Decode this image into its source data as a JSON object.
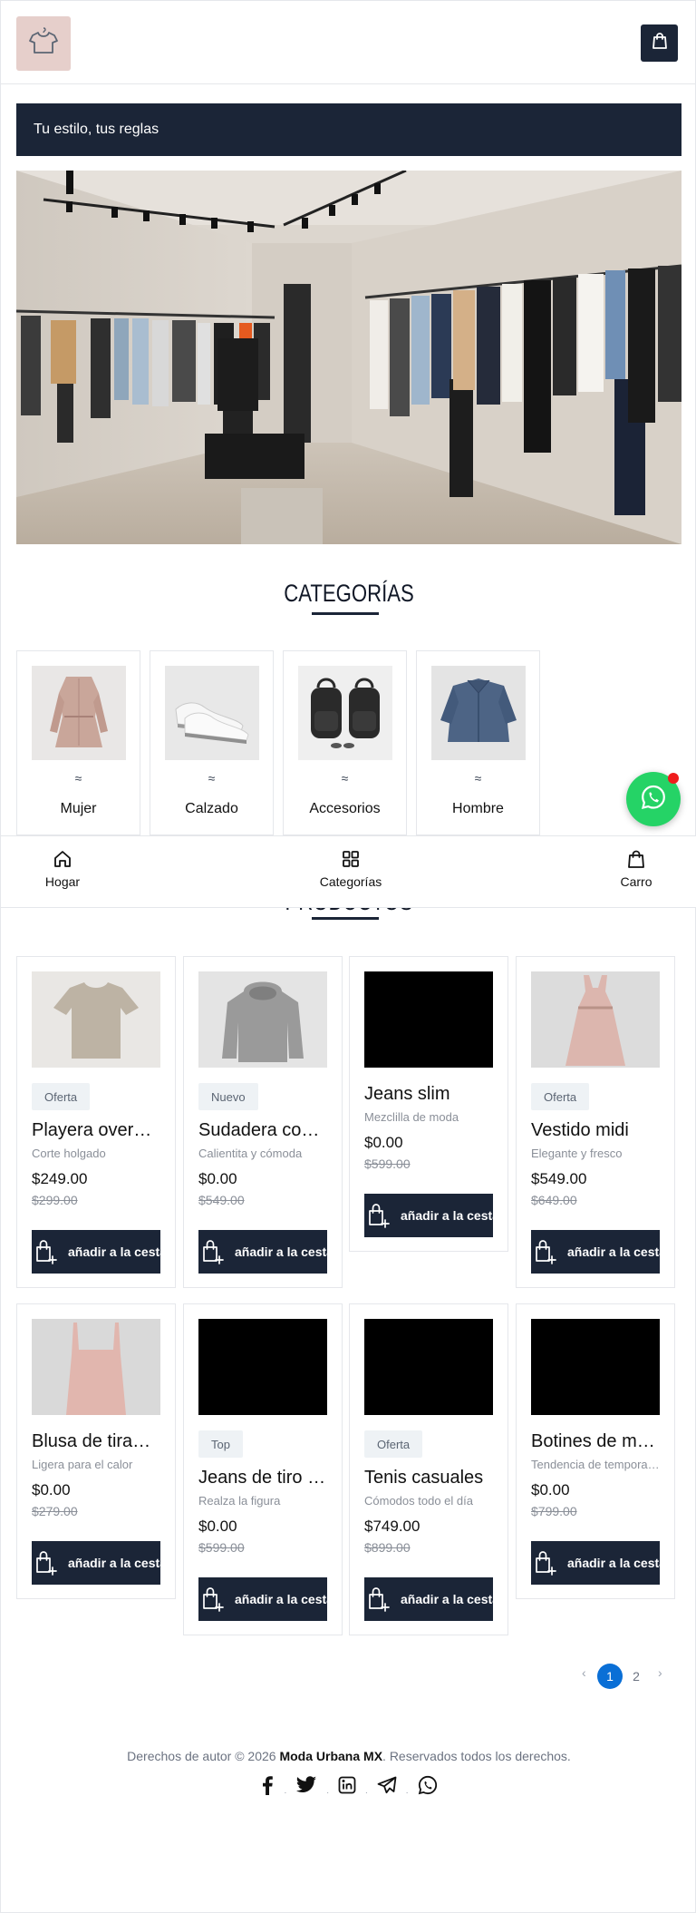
{
  "header": {
    "logo_icon": "tshirt-icon",
    "cart_icon": "shopping-bag-icon"
  },
  "banner": {
    "text": "Tu estilo, tus reglas"
  },
  "categories": {
    "title": "CATEGORÍAS",
    "items": [
      {
        "symbol": "≈",
        "label": "Mujer"
      },
      {
        "symbol": "≈",
        "label": "Calzado"
      },
      {
        "symbol": "≈",
        "label": "Accesorios"
      },
      {
        "symbol": "≈",
        "label": "Hombre"
      }
    ]
  },
  "products_title": "PRODUCTOS",
  "products": [
    {
      "badge": "Oferta",
      "name": "Playera oversize",
      "desc": "Corte holgado",
      "price": "$249.00",
      "old": "$299.00",
      "button": "añadir a la cesta"
    },
    {
      "badge": "Nuevo",
      "name": "Sudadera con capucha",
      "desc": "Calientita y cómoda",
      "price": "$0.00",
      "old": "$549.00",
      "button": "añadir a la cesta"
    },
    {
      "badge": "",
      "name": "Jeans slim",
      "desc": "Mezclilla de moda",
      "price": "$0.00",
      "old": "$599.00",
      "button": "añadir a la cesta"
    },
    {
      "badge": "Oferta",
      "name": "Vestido midi",
      "desc": "Elegante y fresco",
      "price": "$549.00",
      "old": "$649.00",
      "button": "añadir a la cesta"
    },
    {
      "badge": "",
      "name": "Blusa de tirantes",
      "desc": "Ligera para el calor",
      "price": "$0.00",
      "old": "$279.00",
      "button": "añadir a la cesta"
    },
    {
      "badge": "Top",
      "name": "Jeans de tiro alto",
      "desc": "Realza la figura",
      "price": "$0.00",
      "old": "$599.00",
      "button": "añadir a la cesta"
    },
    {
      "badge": "Oferta",
      "name": "Tenis casuales",
      "desc": "Cómodos todo el día",
      "price": "$749.00",
      "old": "$899.00",
      "button": "añadir a la cesta"
    },
    {
      "badge": "",
      "name": "Botines de moda",
      "desc": "Tendencia de temporada",
      "price": "$0.00",
      "old": "$799.00",
      "button": "añadir a la cesta"
    }
  ],
  "bottom_nav": [
    {
      "label": "Hogar",
      "icon": "home-icon"
    },
    {
      "label": "Categorías",
      "icon": "grid-icon"
    },
    {
      "label": "Carro",
      "icon": "shopping-bag-icon"
    }
  ],
  "pagination": {
    "prev": "‹",
    "pages": [
      "1",
      "2"
    ],
    "current": "1",
    "next": "›"
  },
  "footer": {
    "prefix": "Derechos de autor © 2026",
    "brand": "Moda Urbana MX",
    "suffix": ". Reservados todos los derechos.",
    "social_separator": "."
  },
  "colors": {
    "primary": "#1b2537",
    "accent": "#0a6fd6",
    "whatsapp": "#25d366",
    "badge_bg": "#eef2f5"
  }
}
